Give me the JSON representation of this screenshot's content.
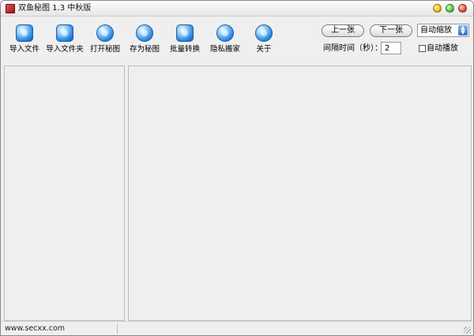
{
  "window": {
    "title": "双鱼秘图 1.3 中秋版"
  },
  "toolbar": {
    "items": [
      {
        "label": "导入文件",
        "icon": "import-file-icon"
      },
      {
        "label": "导入文件夹",
        "icon": "import-folder-icon"
      },
      {
        "label": "打开秘图",
        "icon": "open-secret-image-icon"
      },
      {
        "label": "存为秘图",
        "icon": "save-secret-image-icon"
      },
      {
        "label": "批量转换",
        "icon": "batch-convert-icon"
      },
      {
        "label": "隐私搬家",
        "icon": "privacy-move-icon"
      },
      {
        "label": "关于",
        "icon": "about-icon"
      }
    ],
    "prev_label": "上一张",
    "next_label": "下一张",
    "zoom_selected": "自动缩放",
    "interval_label": "间隔时间（秒）：",
    "interval_value": "2",
    "autoplay_label": "自动播放",
    "autoplay_checked": false
  },
  "status": {
    "url": "www.secxx.com"
  },
  "colors": {
    "window_bg": "#efefef",
    "icon_blue": "#2f8fe6"
  }
}
